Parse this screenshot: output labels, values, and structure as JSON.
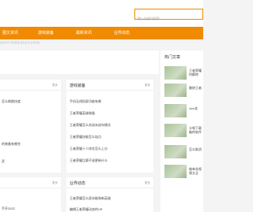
{
  "search": {
    "placeholder": "输入关键词搜索..."
  },
  "nav": {
    "items": [
      {
        "label": "图文资讯"
      },
      {
        "label": "游戏装备"
      },
      {
        "label": "最新资讯"
      },
      {
        "label": "业界动态"
      }
    ]
  },
  "subtitle": "最新资讯 游戏装备 最新资讯 业界动态",
  "panels": {
    "left_top": {
      "title": "",
      "more": "更多",
      "items": [
        "怎么刷跑技度",
        "",
        "",
        "",
        "",
        "的装备有哪些",
        "",
        "武"
      ]
    },
    "game_gear": {
      "title": "游戏装备",
      "more": "更多",
      "items": [
        "手机无线投屏功能有哪",
        "王者荣耀英雄装备",
        "王者荣耀怎么关闭未成年模式",
        "王者荣耀技能怎么加点",
        "王者荣耀十人排名怎么上分",
        "王者荣耀比赛不该更新什么"
      ]
    },
    "left_bottom": {
      "title": "",
      "more": "更多",
      "items": [
        "",
        "手开2022"
      ]
    },
    "industry": {
      "title": "业界动态",
      "more": "更多",
      "items": [
        "王者荣耀怎么弄技能和新英雄",
        "编辑王者荣耀动态的VR"
      ]
    },
    "hot": {
      "title": "热门文章",
      "items": [
        {
          "text": "王者荣耀何解除"
        },
        {
          "text": "删除王者"
        },
        {
          "text": "vivo花"
        },
        {
          "text": "卡顿下载破的软件"
        },
        {
          "text": "怎么取消"
        },
        {
          "text": "做单非视频太全"
        }
      ]
    }
  },
  "colors": {
    "accent": "#f08a00"
  }
}
